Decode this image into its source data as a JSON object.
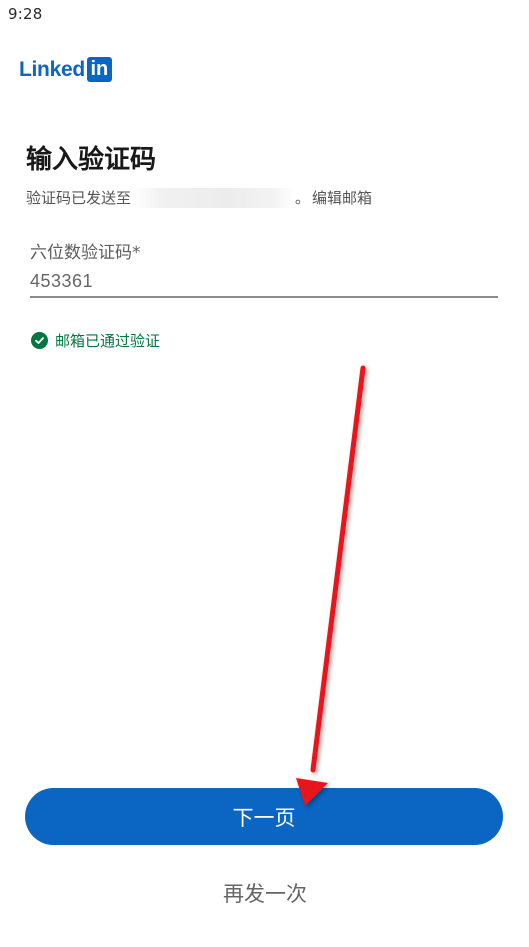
{
  "status_bar": {
    "time": "9:28"
  },
  "brand": {
    "word": "Linked",
    "box": "in",
    "color": "#0a66c2"
  },
  "page": {
    "title": "输入验证码",
    "subtitle_prefix": "验证码已发送至",
    "subtitle_suffix": "。",
    "edit_email": "编辑邮箱"
  },
  "code_field": {
    "label": "六位数验证码*",
    "value": "453361"
  },
  "verification": {
    "message": "邮箱已通过验证",
    "color": "#057642"
  },
  "actions": {
    "next_label": "下一页",
    "resend_label": "再发一次"
  },
  "annotation": {
    "color": "#e8141b"
  }
}
